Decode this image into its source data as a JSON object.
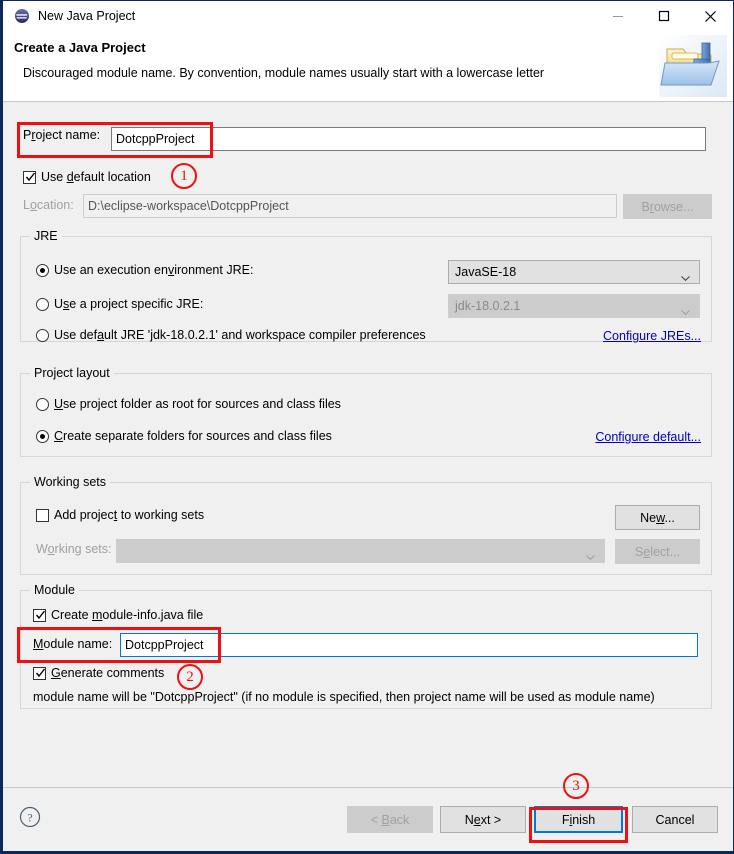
{
  "window": {
    "title": "New Java Project",
    "icon": "eclipse-icon",
    "minimize_label": "—",
    "maximize_label": "□",
    "close_label": "✕"
  },
  "header": {
    "title": "Create a Java Project",
    "description": "Discouraged module name. By convention, module names usually start with a lowercase letter",
    "icon": "java-project-folder-icon"
  },
  "project": {
    "name_label_pre": "P",
    "name_label_key": "r",
    "name_label_post": "oject name:",
    "name_value": "DotcppProject",
    "use_default_location_pre": "Use ",
    "use_default_location_key": "d",
    "use_default_location_post": "efault location",
    "use_default_location_checked": true,
    "location_label_pre": "L",
    "location_label_key": "o",
    "location_label_post": "cation:",
    "location_value": "D:\\eclipse-workspace\\DotcppProject",
    "browse_label_pre": "B",
    "browse_label_key": "r",
    "browse_label_post": "owse..."
  },
  "jre": {
    "group_title": "JRE",
    "option_exec_env_pre": "Use an execution en",
    "option_exec_env_key": "v",
    "option_exec_env_post": "ironment JRE:",
    "option_exec_env_selected": true,
    "exec_env_value": "JavaSE-18",
    "option_specific_pre": "U",
    "option_specific_key": "s",
    "option_specific_post": "e a project specific JRE:",
    "option_specific_selected": false,
    "specific_value": "jdk-18.0.2.1",
    "option_default_pre": "Use def",
    "option_default_key": "a",
    "option_default_post": "ult JRE 'jdk-18.0.2.1' and workspace compiler preferences",
    "option_default_selected": false,
    "configure_link": "Configure JREs..."
  },
  "layout": {
    "group_title": "Project layout",
    "option_root_pre": "",
    "option_root_key": "U",
    "option_root_post": "se project folder as root for sources and class files",
    "option_root_selected": false,
    "option_separate_pre": "",
    "option_separate_key": "C",
    "option_separate_post": "reate separate folders for sources and class files",
    "option_separate_selected": true,
    "configure_link": "Configure default..."
  },
  "working_sets": {
    "group_title": "Working sets",
    "add_label_pre": "Add projec",
    "add_label_key": "t",
    "add_label_post": " to working sets",
    "add_checked": false,
    "new_label_pre": "Ne",
    "new_label_key": "w",
    "new_label_post": "...",
    "sets_label_pre": "W",
    "sets_label_key": "o",
    "sets_label_post": "rking sets:",
    "sets_value": "",
    "select_label_pre": "S",
    "select_label_key": "e",
    "select_label_post": "lect..."
  },
  "module": {
    "group_title": "Module",
    "create_info_pre": "Create ",
    "create_info_key": "m",
    "create_info_post": "odule-info.java file",
    "create_info_checked": true,
    "name_label_pre": "",
    "name_label_key": "M",
    "name_label_post": "odule name:",
    "name_value": "DotcppProject",
    "generate_comments_pre": "",
    "generate_comments_key": "G",
    "generate_comments_post": "enerate comments",
    "generate_comments_checked": true,
    "hint": "module name will be \"DotcppProject\"  (if no module is specified, then project name will be used as module name)"
  },
  "footer": {
    "help_icon": "help-icon",
    "back_pre": "< ",
    "back_key": "B",
    "back_post": "ack",
    "back_disabled": true,
    "next_pre": "N",
    "next_key": "e",
    "next_post": "xt >",
    "finish_pre": "F",
    "finish_key": "i",
    "finish_post": "nish",
    "cancel_label": "Cancel"
  },
  "annotations": {
    "one": "①",
    "one_text": "1",
    "two_text": "2",
    "three_text": "3",
    "color": "#ee1111"
  }
}
